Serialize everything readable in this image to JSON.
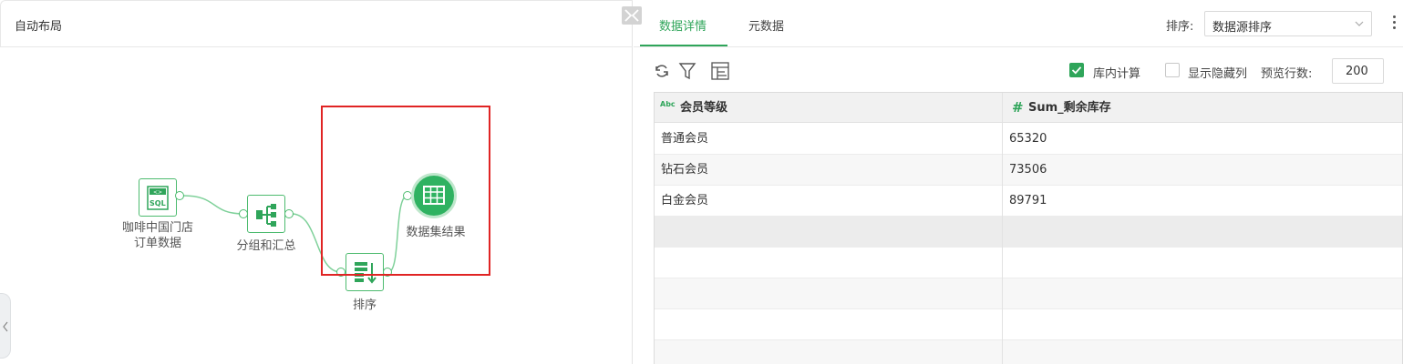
{
  "left_panel": {
    "title": "自动布局",
    "nodes": {
      "source": {
        "label_line1": "咖啡中国门店",
        "label_line2": "订单数据",
        "icon": "sql-icon"
      },
      "group": {
        "label": "分组和汇总",
        "icon": "group-summary-icon"
      },
      "sort": {
        "label": "排序",
        "icon": "sort-icon"
      },
      "result": {
        "label": "数据集结果",
        "icon": "table-icon"
      }
    }
  },
  "tabs": [
    {
      "label": "数据详情",
      "active": true
    },
    {
      "label": "元数据",
      "active": false
    }
  ],
  "sort": {
    "label": "排序:",
    "value": "数据源排序"
  },
  "toolbar": {
    "icons": [
      "refresh-icon",
      "filter-icon",
      "column-settings-icon"
    ],
    "in_db_compute": {
      "label": "库内计算",
      "checked": true
    },
    "show_hidden": {
      "label": "显示隐藏列",
      "checked": false
    },
    "preview_rows": {
      "label": "预览行数:",
      "value": "200"
    }
  },
  "table": {
    "columns": [
      {
        "type_badge": "Abc",
        "name": "会员等级"
      },
      {
        "type_badge": "#",
        "name": "Sum_剩余库存"
      }
    ],
    "rows": [
      [
        "普通会员",
        "65320"
      ],
      [
        "钻石会员",
        "73506"
      ],
      [
        "白金会员",
        "89791"
      ]
    ]
  },
  "colors": {
    "accent": "#2fa55a",
    "node_green": "#4dbb6f",
    "highlight": "#e02424"
  }
}
